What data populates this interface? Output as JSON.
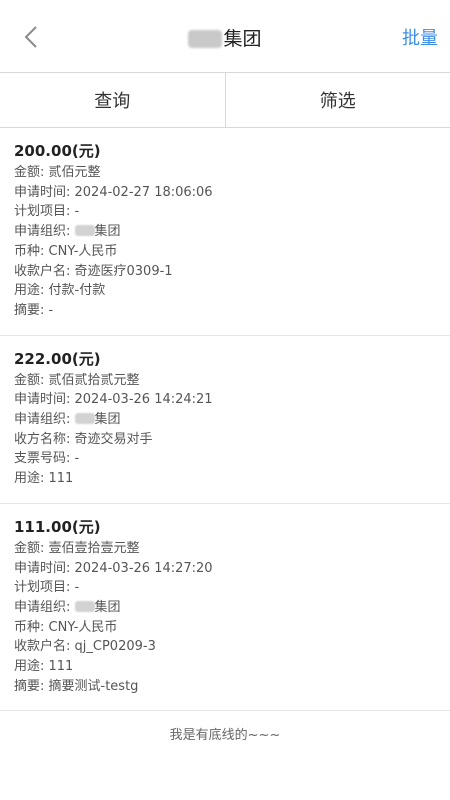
{
  "navbar": {
    "title": "集团",
    "batch_label": "批量"
  },
  "toolbar": {
    "query_label": "查询",
    "filter_label": "筛选"
  },
  "records": [
    {
      "amount": "200.00(元)",
      "lines": [
        "金额: 贰佰元整",
        "申请时间: 2024-02-27 18:06:06",
        "计划项目: -",
        "申请组织: 集团",
        "币种: CNY-人民币",
        "收款户名: 奇迹医疗0309-1",
        "用途: 付款-付款",
        "摘要: -"
      ]
    },
    {
      "amount": "222.00(元)",
      "lines": [
        "金额: 贰佰贰拾贰元整",
        "申请时间: 2024-03-26 14:24:21",
        "申请组织: 集团",
        "收方名称: 奇迹交易对手",
        "支票号码: -",
        "用途: 111"
      ]
    },
    {
      "amount": "111.00(元)",
      "lines": [
        "金额: 壹佰壹拾壹元整",
        "申请时间: 2024-03-26 14:27:20",
        "计划项目: -",
        "申请组织: 集团",
        "币种: CNY-人民币",
        "收款户名: qj_CP0209-3",
        "用途: 111",
        "摘要: 摘要测试-testg"
      ]
    }
  ],
  "footer_text": "我是有底线的~~~"
}
